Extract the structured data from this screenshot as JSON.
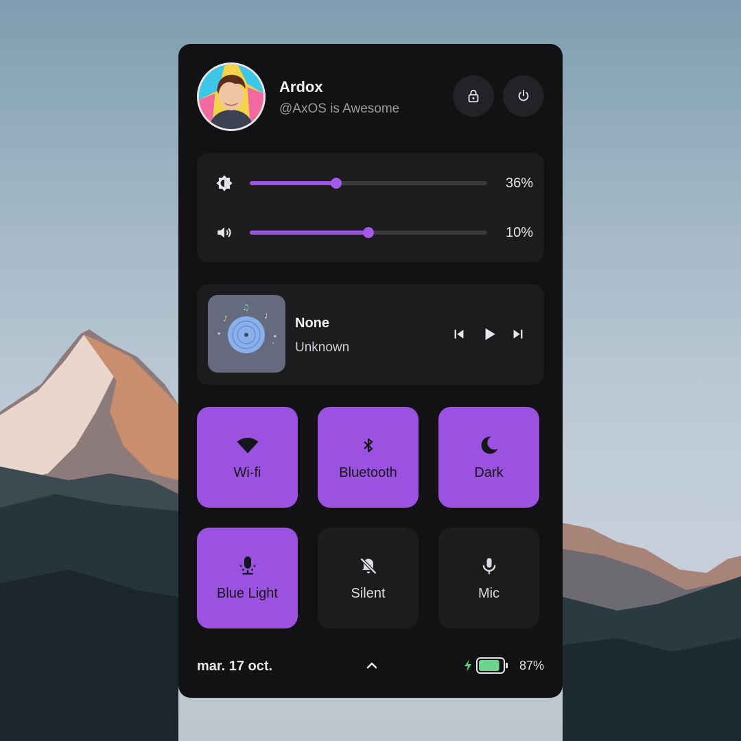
{
  "user": {
    "name": "Ardox",
    "handle": "@AxOS is Awesome"
  },
  "header_buttons": [
    {
      "name": "lock",
      "icon": "lock-icon"
    },
    {
      "name": "power",
      "icon": "power-icon"
    }
  ],
  "sliders": {
    "brightness": {
      "icon": "brightness-icon",
      "value": 36,
      "label": "36%"
    },
    "volume": {
      "icon": "volume-icon",
      "value": 10,
      "label": "10%"
    }
  },
  "media": {
    "title": "None",
    "artist": "Unknown",
    "controls": [
      "skip-previous-icon",
      "play-icon",
      "skip-next-icon"
    ]
  },
  "toggles": [
    {
      "label": "Wi-fi",
      "icon": "wifi-icon",
      "active": true
    },
    {
      "label": "Bluetooth",
      "icon": "bluetooth-icon",
      "active": true
    },
    {
      "label": "Dark",
      "icon": "moon-icon",
      "active": true
    },
    {
      "label": "Blue Light",
      "icon": "lightbulb-icon",
      "active": true
    },
    {
      "label": "Silent",
      "icon": "bell-off-icon",
      "active": false
    },
    {
      "label": "Mic",
      "icon": "mic-icon",
      "active": false
    }
  ],
  "footer": {
    "date": "mar. 17 oct.",
    "battery": {
      "percent": 87,
      "label": "87%",
      "charging": true
    }
  },
  "colors": {
    "accent": "#9c52e0",
    "panel": "#121214",
    "card": "#1c1c1f",
    "battery_fill": "#6fd38d",
    "charging_bolt": "#5fcf7a"
  }
}
